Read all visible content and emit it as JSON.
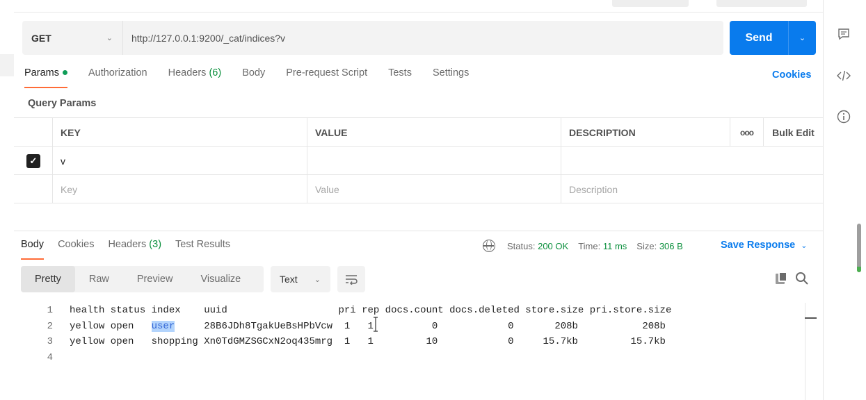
{
  "request": {
    "method": "GET",
    "url": "http://127.0.0.1:9200/_cat/indices?v",
    "send_label": "Send"
  },
  "request_tabs": {
    "params": "Params",
    "authorization": "Authorization",
    "headers": "Headers",
    "headers_count": "(6)",
    "body": "Body",
    "prerequest": "Pre-request Script",
    "tests": "Tests",
    "settings": "Settings",
    "cookies": "Cookies"
  },
  "query_params": {
    "title": "Query Params",
    "headers": {
      "key": "KEY",
      "value": "VALUE",
      "description": "DESCRIPTION",
      "more": "ooo",
      "bulk_edit": "Bulk Edit"
    },
    "rows": [
      {
        "checked": true,
        "key": "v",
        "value": "",
        "description": ""
      }
    ],
    "placeholders": {
      "key": "Key",
      "value": "Value",
      "description": "Description"
    }
  },
  "response_tabs": {
    "body": "Body",
    "cookies": "Cookies",
    "headers": "Headers",
    "headers_count": "(3)",
    "test_results": "Test Results"
  },
  "response_status": {
    "status_label": "Status:",
    "status_value": "200 OK",
    "time_label": "Time:",
    "time_value": "11 ms",
    "size_label": "Size:",
    "size_value": "306 B",
    "save_response": "Save Response"
  },
  "view_modes": {
    "pretty": "Pretty",
    "raw": "Raw",
    "preview": "Preview",
    "visualize": "Visualize",
    "format": "Text"
  },
  "response_lines": [
    {
      "num": "1",
      "pre": "health status index    uuid                   pri rep docs.count docs.deleted store.size pri.store.size",
      "sel": "",
      "post": ""
    },
    {
      "num": "2",
      "pre": "yellow open   ",
      "sel": "user",
      "post": "     28B6JDh8TgakUeBsHPbVcw  1   1          0            0       208b           208b"
    },
    {
      "num": "3",
      "pre": "yellow open   shopping Xn0TdGMZSGCxN2oq435mrg  1   1         10            0     15.7kb         15.7kb",
      "sel": "",
      "post": ""
    },
    {
      "num": "4",
      "pre": "",
      "sel": "",
      "post": ""
    }
  ],
  "colors": {
    "accent": "#097bed",
    "tab_underline": "#ff6c37",
    "status_green": "#0a8f3c"
  },
  "icons": [
    "comment-icon",
    "code-icon",
    "info-icon",
    "globe-icon",
    "copy-icon",
    "search-icon",
    "wrap-lines-icon",
    "chevron-down-icon",
    "checkbox-checked-icon"
  ]
}
